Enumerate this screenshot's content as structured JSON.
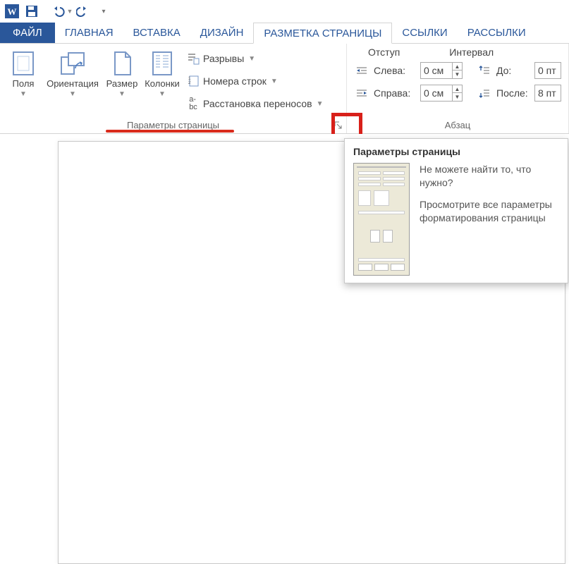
{
  "qat": {
    "word_icon": "W",
    "save": "save",
    "undo": "undo",
    "redo": "redo"
  },
  "tabs": {
    "file": "ФАЙЛ",
    "home": "ГЛАВНАЯ",
    "insert": "ВСТАВКА",
    "design": "ДИЗАЙН",
    "layout": "РАЗМЕТКА СТРАНИЦЫ",
    "references": "ССЫЛКИ",
    "mailings": "РАССЫЛКИ"
  },
  "ribbon": {
    "page_setup": {
      "title": "Параметры страницы",
      "margins": "Поля",
      "orientation": "Ориентация",
      "size": "Размер",
      "columns": "Колонки",
      "breaks": "Разрывы",
      "line_numbers": "Номера строк",
      "hyphenation": "Расстановка переносов"
    },
    "paragraph": {
      "title": "Абзац",
      "indent_header": "Отступ",
      "spacing_header": "Интервал",
      "left_label": "Слева:",
      "right_label": "Справа:",
      "before_label": "До:",
      "after_label": "После:",
      "left_val": "0 см",
      "right_val": "0 см",
      "before_val": "0 пт",
      "after_val": "8 пт"
    }
  },
  "tooltip": {
    "title": "Параметры страницы",
    "text1": "Не можете найти то, что нужно?",
    "text2": "Просмотрите все параметры форматирования страницы"
  }
}
